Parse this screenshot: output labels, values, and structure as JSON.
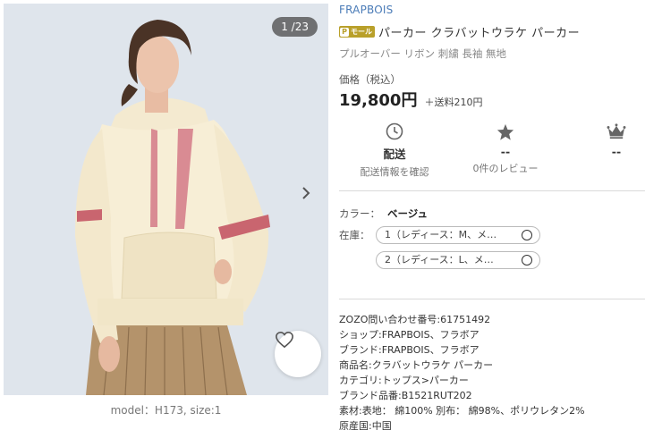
{
  "gallery": {
    "counter": "1 /23",
    "model_caption": "model：H173,  size:1",
    "icons": {
      "next": "chevron-right-icon",
      "favorite": "heart-icon"
    }
  },
  "product": {
    "brand": "FRAPBOIS",
    "badge": "モール",
    "title": "パーカー クラバットウラケ パーカー",
    "subtitle": "プルオーバー リボン 刺繍 長袖 無地",
    "price_label": "価格（税込）",
    "price": "19,800円",
    "shipping": "＋送料210円"
  },
  "stats": [
    {
      "icon": "clock-icon",
      "value": "配送",
      "sub": "配送情報を確認"
    },
    {
      "icon": "star-icon",
      "value": "--",
      "sub": "0件のレビュー"
    },
    {
      "icon": "crown-icon",
      "value": "--",
      "sub": ""
    }
  ],
  "selection": {
    "color_label": "カラー：",
    "color_value": "ベージュ",
    "stock_label": "在庫：",
    "options": [
      "1（レディース：M、メ…",
      "2（レディース：L、メ…"
    ]
  },
  "details": [
    "ZOZO問い合わせ番号:61751492",
    "ショップ:FRAPBOIS、フラボア",
    "ブランド:FRAPBOIS、フラボア",
    "商品名:クラバットウラケ パーカー",
    "カテゴリ:トップス>パーカー",
    "ブランド品番:B1521RUT202",
    "素材:表地： 綿100% 別布： 綿98%、ポリウレタン2%",
    "原産国:中国"
  ],
  "colors": {
    "brand_link": "#4a7bb7",
    "badge": "#b9a02a",
    "image_bg": "#dfe5ec"
  }
}
